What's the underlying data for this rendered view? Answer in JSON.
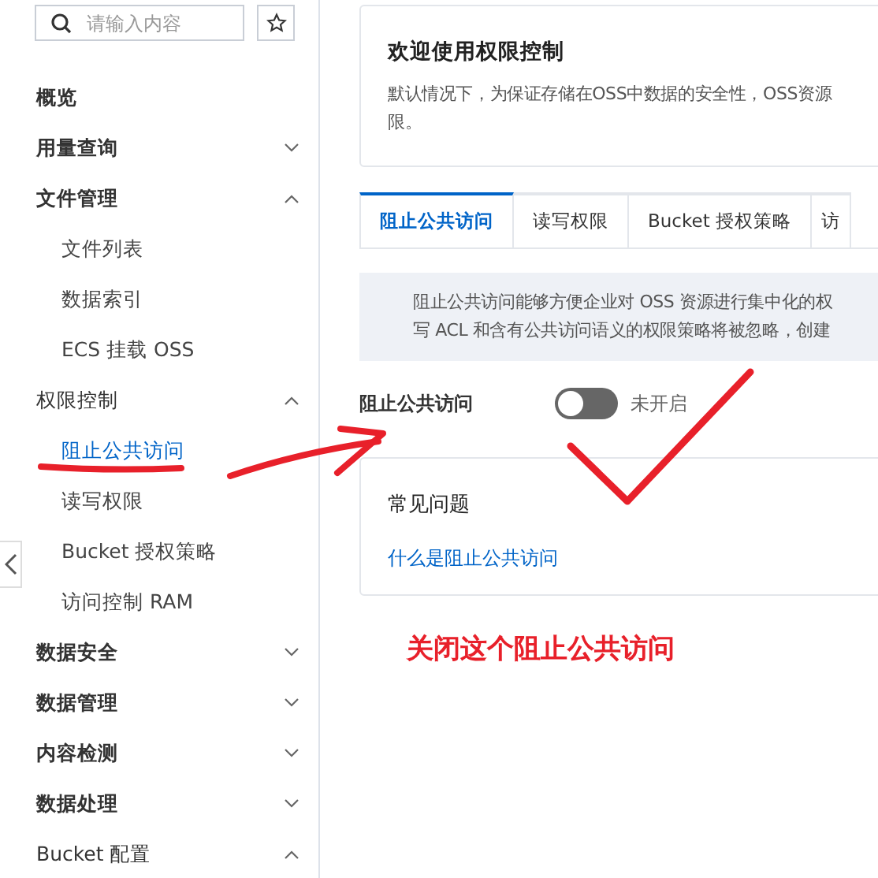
{
  "sidebar": {
    "search": {
      "placeholder": "请输入内容"
    },
    "items": [
      {
        "label": "概览",
        "bold": true
      },
      {
        "label": "用量查询",
        "bold": true,
        "expanded": false
      },
      {
        "label": "文件管理",
        "bold": true,
        "expanded": true,
        "children": [
          {
            "label": "文件列表",
            "selected": false
          },
          {
            "label": "数据索引",
            "selected": false
          },
          {
            "label": "ECS 挂载 OSS",
            "selected": false
          }
        ]
      },
      {
        "label": "权限控制",
        "bold": false,
        "expanded": true,
        "children": [
          {
            "label": "阻止公共访问",
            "selected": true
          },
          {
            "label": "读写权限",
            "selected": false
          },
          {
            "label": "Bucket 授权策略",
            "selected": false
          },
          {
            "label": "访问控制 RAM",
            "selected": false
          }
        ]
      },
      {
        "label": "数据安全",
        "bold": true,
        "expanded": false
      },
      {
        "label": "数据管理",
        "bold": true,
        "expanded": false
      },
      {
        "label": "内容检测",
        "bold": true,
        "expanded": false
      },
      {
        "label": "数据处理",
        "bold": true,
        "expanded": false
      },
      {
        "label": "Bucket 配置",
        "bold": false,
        "expanded": true
      }
    ]
  },
  "welcome": {
    "title": "欢迎使用权限控制",
    "description_lines": [
      "默认情况下，为保证存储在OSS中数据的安全性，OSS资源",
      "限。"
    ]
  },
  "tabs": [
    {
      "label": "阻止公共访问",
      "selected": true
    },
    {
      "label": "读写权限",
      "selected": false
    },
    {
      "label": "Bucket 授权策略",
      "selected": false
    },
    {
      "label": "访",
      "selected": false
    }
  ],
  "notice": {
    "lines": [
      "阻止公共访问能够方便企业对 OSS 资源进行集中化的权",
      "写 ACL 和含有公共访问语义的权限策略将被忽略，创建"
    ]
  },
  "setting": {
    "label": "阻止公共访问",
    "on": false,
    "status": "未开启"
  },
  "faq": {
    "title": "常见问题",
    "links": [
      "什么是阻止公共访问"
    ]
  },
  "annotation": {
    "text": "关闭这个阻止公共访问"
  }
}
